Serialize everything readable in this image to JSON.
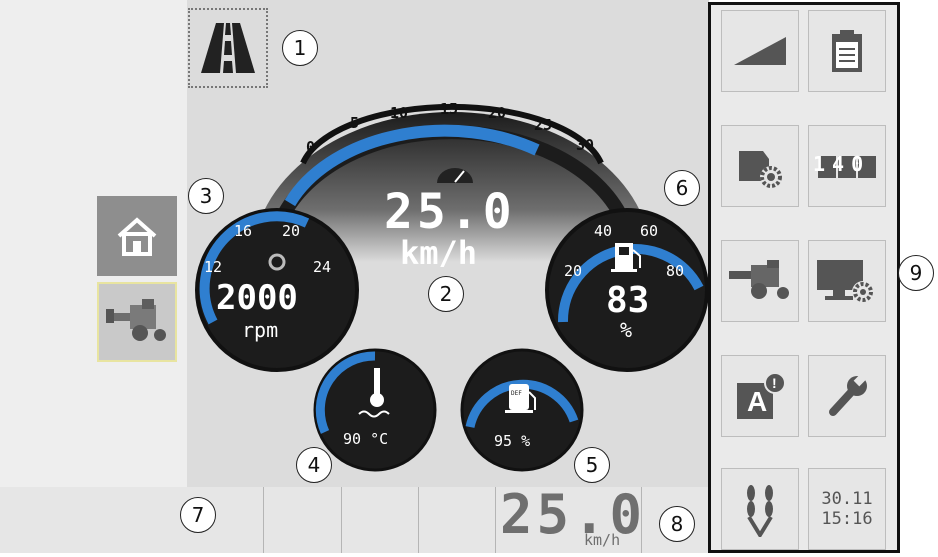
{
  "gauges": {
    "speed": {
      "scale_ticks": [
        "0",
        "5",
        "10",
        "15",
        "20",
        "25",
        "30"
      ],
      "value": "25.0",
      "unit": "km/h",
      "level": 0.83
    },
    "engine": {
      "scale_ticks": [
        "12",
        "16",
        "20",
        "24"
      ],
      "value": "2000",
      "unit": "rpm"
    },
    "fuel": {
      "scale_ticks": [
        "20",
        "40",
        "60",
        "80"
      ],
      "value": "83",
      "unit": "%"
    },
    "coolant": {
      "value": "90 °C"
    },
    "def": {
      "value": "95 %",
      "icon_text": "DEF"
    }
  },
  "callouts": [
    "1",
    "2",
    "3",
    "4",
    "5",
    "6",
    "7",
    "8",
    "9"
  ],
  "status_bar": {
    "speed_value": "25.0",
    "speed_unit": "km/h"
  },
  "right_panel": {
    "date": "30.11",
    "time": "15:16",
    "counter_digits": "140",
    "alert_letter": "A",
    "alert_badge": "!"
  },
  "icons": {
    "road_mode": "road-icon",
    "home": "home-icon",
    "combine": "combine-harvester-icon",
    "ramp": "ramp-icon",
    "clipboard": "clipboard-icon",
    "engine_settings": "engine-gear-icon",
    "display_settings": "monitor-gear-icon",
    "wrench": "wrench-icon",
    "crop": "wheat-icon"
  },
  "colors": {
    "gauge_arc": "#2f7fd0",
    "gauge_body": "#1c1c1c",
    "panel_bg": "#dcdcdc",
    "tile_bg": "#e6e6e6",
    "home_btn_bg": "#8e8e8e",
    "combine_btn_border": "#e8e4a0"
  }
}
